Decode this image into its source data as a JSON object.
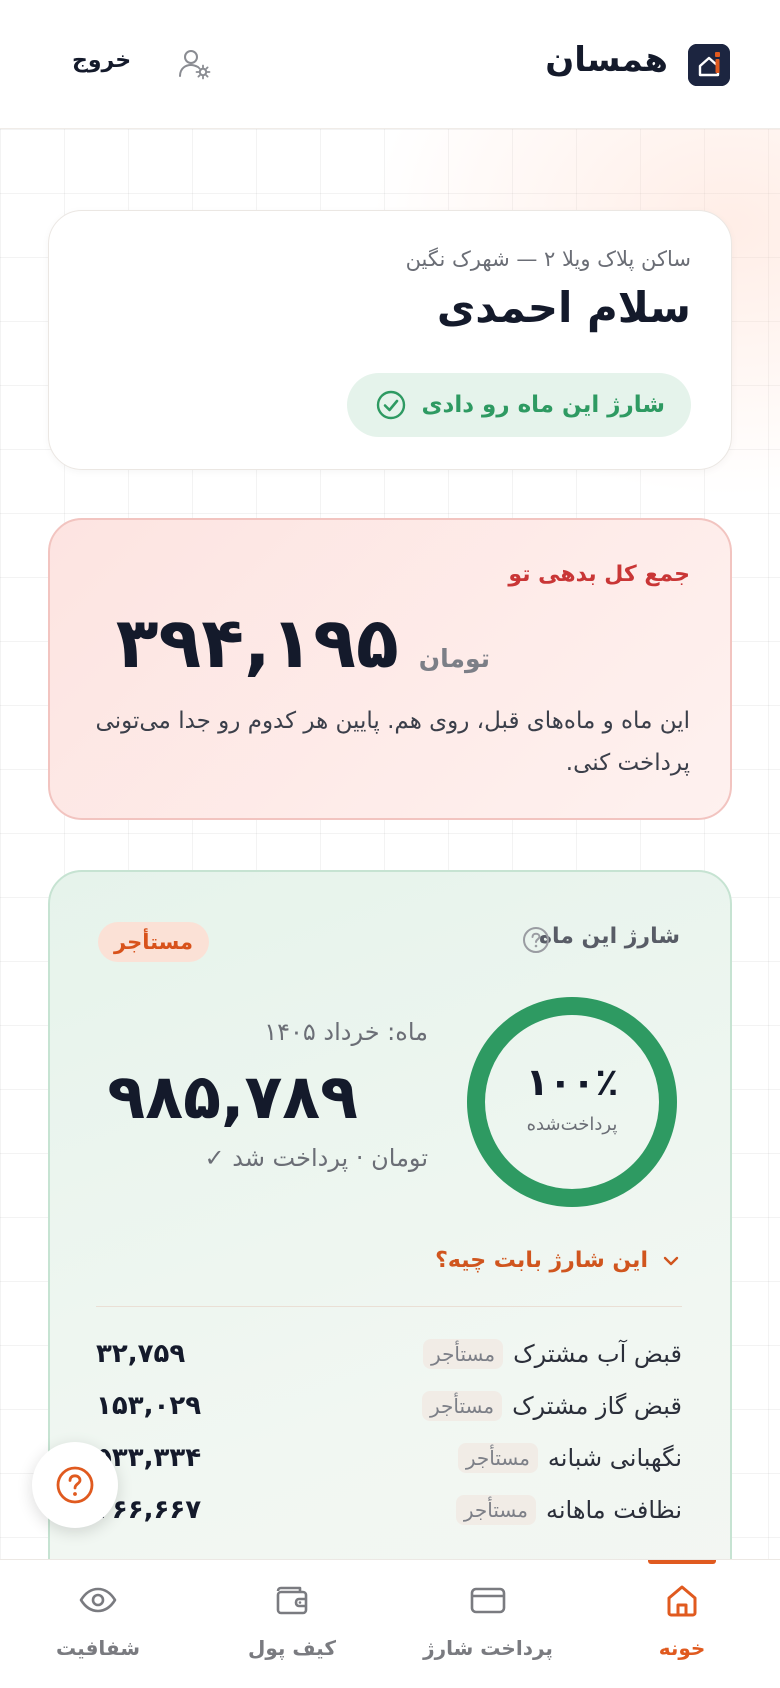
{
  "header": {
    "app_name": "همسان",
    "logout_label": "خروج"
  },
  "welcome": {
    "resident_line": "ساکن پلاک ویلا ۲ — شهرک نگین",
    "greeting": "سلام احمدی",
    "paid_status": "شارژ این ماه رو دادی"
  },
  "debt": {
    "title": "جمع کل بدهی تو",
    "amount": "۳۹۴,۱۹۵",
    "unit": "تومان",
    "description": "این ماه و ماه‌های قبل، روی هم. پایین هر کدوم رو جدا می‌تونی پرداخت کنی."
  },
  "charge": {
    "label": "شارژ این ماه",
    "badge": "مستأجر",
    "percent_text": "۱۰۰٪",
    "percent_value": 100,
    "percent_label": "پرداخت‌شده",
    "month": "ماه: خرداد ۱۴۰۵",
    "amount": "۹۸۵,۷۸۹",
    "status": "تومان · پرداخت شد ✓",
    "breakdown_toggle": "این شارژ بابت چیه؟",
    "items": [
      {
        "name": "قبض آب مشترک",
        "tag": "مستأجر",
        "amount": "۳۲,۷۵۹"
      },
      {
        "name": "قبض گاز مشترک",
        "tag": "مستأجر",
        "amount": "۱۵۳,۰۲۹"
      },
      {
        "name": "نگهبانی شبانه",
        "tag": "مستأجر",
        "amount": "۵۳۳,۳۳۴"
      },
      {
        "name": "نظافت ماهانه",
        "tag": "مستأجر",
        "amount": "۲۶۶,۶۶۷"
      }
    ]
  },
  "nav": {
    "items": [
      {
        "label": "خونه",
        "icon": "home-icon",
        "active": true
      },
      {
        "label": "پرداخت شارژ",
        "icon": "credit-card-icon",
        "active": false
      },
      {
        "label": "کیف پول",
        "icon": "wallet-icon",
        "active": false
      },
      {
        "label": "شفافیت",
        "icon": "eye-icon",
        "active": false
      }
    ]
  },
  "colors": {
    "accent": "#e05a1f",
    "success": "#2e9a62",
    "danger": "#c93636",
    "navy": "#1c2540"
  }
}
